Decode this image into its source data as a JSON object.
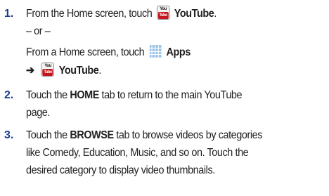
{
  "steps": [
    {
      "number": "1.",
      "lines": {
        "a_pre": "From the Home screen, touch",
        "a_bold": "YouTube",
        "a_post": ".",
        "or": "– or –",
        "c_pre": "From a Home screen, touch",
        "c_bold": "Apps",
        "arrow": "➔",
        "d_bold": "YouTube",
        "d_post": "."
      }
    },
    {
      "number": "2.",
      "lines": {
        "a_pre": "Touch the",
        "a_bold": "HOME",
        "a_post": "tab to return to the main YouTube",
        "b": "page."
      }
    },
    {
      "number": "3.",
      "lines": {
        "a_pre": "Touch the",
        "a_bold": "BROWSE",
        "a_post": "tab to browse videos by categories",
        "b": "like Comedy, Education, Music, and so on. Touch the",
        "c": "desired category to display video thumbnails."
      }
    }
  ],
  "icons": {
    "youtube_top": "You",
    "youtube_bottom": "Tube",
    "apps_color": "#9bc3e8",
    "youtube_color": "#c4161c"
  }
}
